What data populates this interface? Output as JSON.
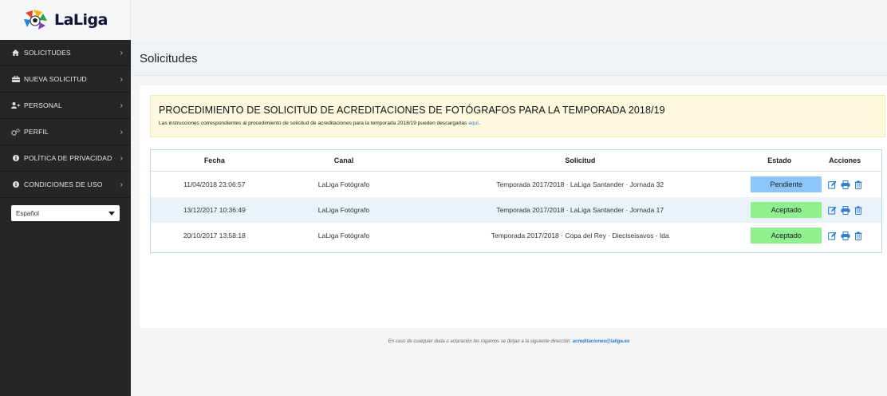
{
  "brand": {
    "name": "LaLiga"
  },
  "sidebar": {
    "items": [
      {
        "label": "SOLICITUDES",
        "icon": "home-icon"
      },
      {
        "label": "NUEVA SOLICITUD",
        "icon": "briefcase-icon"
      },
      {
        "label": "PERSONAL",
        "icon": "add-user-icon"
      },
      {
        "label": "PERFIL",
        "icon": "gears-icon"
      },
      {
        "label": "POLÍTICA DE PRIVACIDAD",
        "icon": "info-icon"
      },
      {
        "label": "CONDICIONES DE USO",
        "icon": "info-icon"
      }
    ],
    "language": {
      "selected": "Español"
    }
  },
  "header": {
    "title": "Solicitudes"
  },
  "notice": {
    "title": "PROCEDIMIENTO DE SOLICITUD DE ACREDITACIONES DE FOTÓGRAFOS PARA LA TEMPORADA 2018/19",
    "text": "Las instrucciones correspondientes al procedimiento de solicitud de acreditaciones para la temporada 2018/19 pueden descargarlas ",
    "link": "aquí",
    "end": "."
  },
  "table": {
    "columns": [
      "Fecha",
      "Canal",
      "Solicitud",
      "Estado",
      "Acciones"
    ],
    "rows": [
      {
        "fecha": "11/04/2018 23:06:57",
        "canal": "LaLiga Fotógrafo",
        "solicitud": "Temporada 2017/2018 · LaLiga Santander · Jornada 32",
        "estado": "Pendiente",
        "estado_color": "#8ec5f8"
      },
      {
        "fecha": "13/12/2017 10:36:49",
        "canal": "LaLiga Fotógrafo",
        "solicitud": "Temporada 2017/2018 · LaLiga Santander · Jornada 17",
        "estado": "Aceptado",
        "estado_color": "#8ef08e"
      },
      {
        "fecha": "20/10/2017 13:58:18",
        "canal": "LaLiga Fotógrafo",
        "solicitud": "Temporada 2017/2018 · Copa del Rey · Dieciseisavos - Ida",
        "estado": "Aceptado",
        "estado_color": "#8ef08e"
      }
    ],
    "action_icons": [
      "edit-icon",
      "print-icon",
      "trash-icon"
    ],
    "action_color": "#2f7fd6"
  },
  "footer": {
    "text": "En caso de cualquier duda o aclaración les rogamos se dirijan a la siguiente dirección: ",
    "email": "acreditaciones@laliga.es"
  }
}
